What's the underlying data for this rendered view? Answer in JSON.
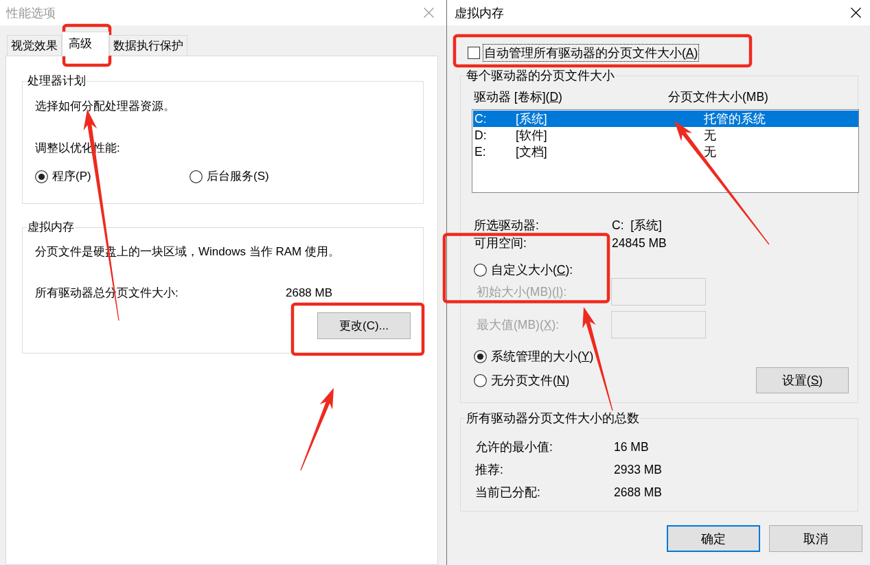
{
  "performance_options_dialog": {
    "title": "性能选项",
    "active": false,
    "tabs": [
      {
        "label": "视觉效果",
        "selected": false
      },
      {
        "label": "高级",
        "selected": true
      },
      {
        "label": "数据执行保护",
        "selected": false
      }
    ],
    "processor_scheduling": {
      "title": "处理器计划",
      "description": "选择如何分配处理器资源。",
      "prompt": "调整以优化性能:",
      "options": [
        {
          "label": "程序(P)",
          "selected": true
        },
        {
          "label": "后台服务(S)",
          "selected": false
        }
      ]
    },
    "virtual_memory": {
      "title": "虚拟内存",
      "description": "分页文件是硬盘上的一块区域，Windows 当作 RAM 使用。",
      "total_label": "所有驱动器总分页文件大小:",
      "total_value": "2688 MB",
      "change_button": "更改(C)..."
    }
  },
  "virtual_memory_dialog": {
    "title": "虚拟内存",
    "active": true,
    "auto_manage": {
      "label": "自动管理所有驱动器的分页文件大小(",
      "access_key": "A",
      "label_end": ")",
      "checked": false,
      "focused": true
    },
    "per_drive": {
      "title": "每个驱动器的分页文件大小",
      "columns": [
        {
          "label": "驱动器 [卷标](",
          "access_key": "D",
          "label_end": ")"
        },
        {
          "label": "分页文件大小(MB)"
        }
      ],
      "drives": [
        {
          "drive": "C:",
          "volume": "[系统]",
          "paging_file_size": "托管的系统",
          "selected": true
        },
        {
          "drive": "D:",
          "volume": "[软件]",
          "paging_file_size": "无",
          "selected": false
        },
        {
          "drive": "E:",
          "volume": "[文档]",
          "paging_file_size": "无",
          "selected": false
        }
      ],
      "details": [
        {
          "label": "所选驱动器:",
          "value": "C:  [系统]"
        },
        {
          "label": "可用空间:",
          "value": "24845 MB"
        }
      ],
      "size_options": [
        {
          "label": "自定义大小(",
          "access_key": "C",
          "label_end": "):",
          "selected": false
        },
        {
          "label": "系统管理的大小(",
          "access_key": "Y",
          "label_end": ")",
          "selected": true
        },
        {
          "label": "无分页文件(",
          "access_key": "N",
          "label_end": ")",
          "selected": false
        }
      ],
      "custom_fields": [
        {
          "label": "初始大小(MB)(",
          "access_key": "I",
          "label_end": "):",
          "disabled": true
        },
        {
          "label": "最大值(MB)(",
          "access_key": "X",
          "label_end": "):",
          "disabled": true
        }
      ],
      "set_button": {
        "label": "设置(",
        "access_key": "S",
        "label_end": ")"
      }
    },
    "totals": {
      "title": "所有驱动器分页文件大小的总数",
      "rows": [
        {
          "label": "允许的最小值:",
          "value": "16 MB"
        },
        {
          "label": "推荐:",
          "value": "2933 MB"
        },
        {
          "label": "当前已分配:",
          "value": "2688 MB"
        }
      ]
    },
    "buttons": [
      {
        "label": "确定",
        "default": true
      },
      {
        "label": "取消",
        "default": false
      }
    ]
  },
  "annotations": [
    {
      "kind": "box"
    },
    {
      "kind": "arrow"
    },
    {
      "kind": "box"
    },
    {
      "kind": "arrow"
    },
    {
      "kind": "box"
    },
    {
      "kind": "arrow"
    },
    {
      "kind": "box"
    },
    {
      "kind": "arrow"
    }
  ]
}
